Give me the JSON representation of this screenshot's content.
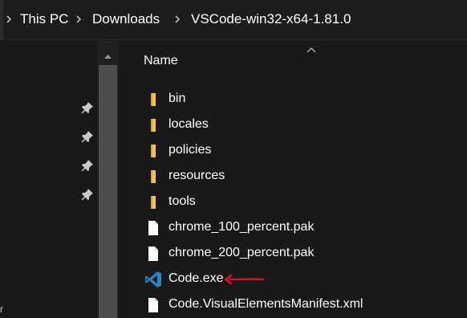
{
  "address_bar": {
    "breadcrumbs": [
      "This PC",
      "Downloads",
      "VSCode-win32-x64-1.81.0"
    ]
  },
  "file_list": {
    "column_header": "Name",
    "items": [
      {
        "name": "bin",
        "type": "folder"
      },
      {
        "name": "locales",
        "type": "folder"
      },
      {
        "name": "policies",
        "type": "folder"
      },
      {
        "name": "resources",
        "type": "folder"
      },
      {
        "name": "tools",
        "type": "folder"
      },
      {
        "name": "chrome_100_percent.pak",
        "type": "file"
      },
      {
        "name": "chrome_200_percent.pak",
        "type": "file"
      },
      {
        "name": "Code.exe",
        "type": "vscode-app"
      },
      {
        "name": "Code.VisualElementsManifest.xml",
        "type": "file"
      }
    ]
  },
  "nav_pane": {
    "edge_text": "r"
  },
  "icons": {
    "folder": "folder-icon",
    "file": "file-icon",
    "vscode": "vscode-icon",
    "pin": "pin-icon",
    "annotation": "red-arrow-annotation"
  },
  "colors": {
    "folder": "#f4c451",
    "vscode_blue": "#2489ca",
    "annotation_red": "#e0141e",
    "background": "#191919"
  }
}
